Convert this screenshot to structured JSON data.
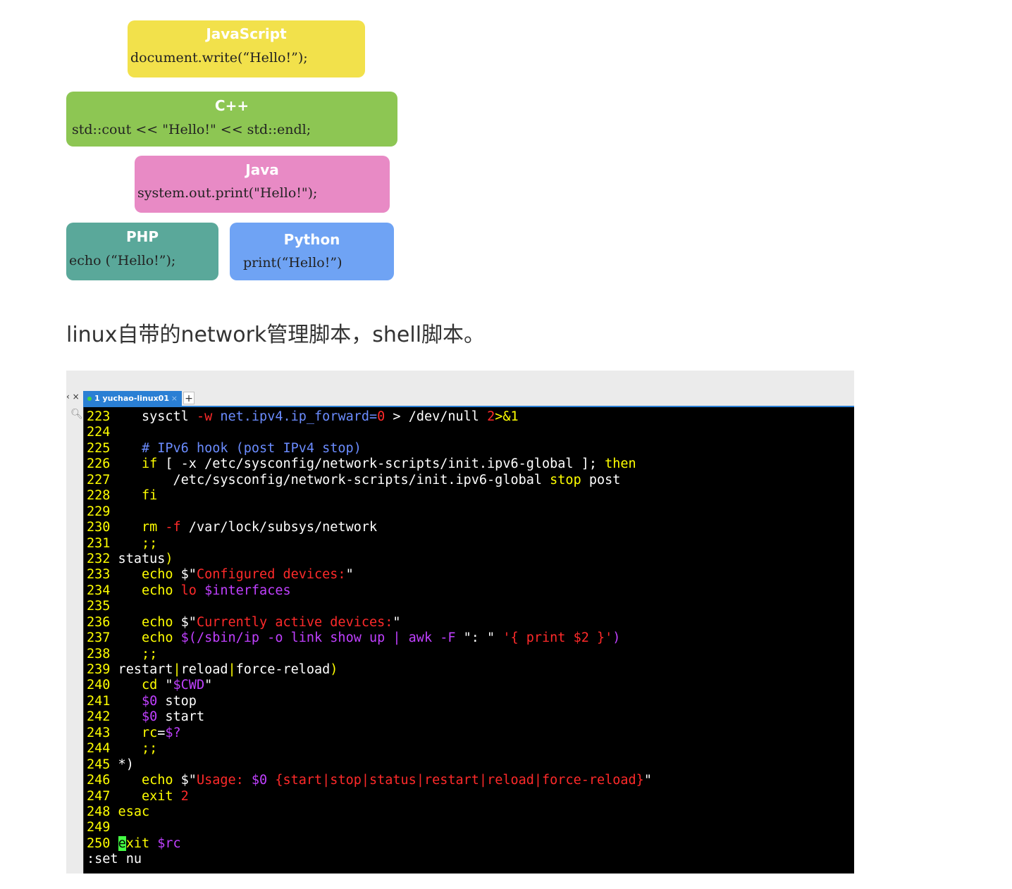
{
  "cards": [
    {
      "title": "JavaScript",
      "code": "document.write(“Hello!”);",
      "color": "#f2e14b"
    },
    {
      "title": "C++",
      "code": "std::cout << \"Hello!\" << std::endl;",
      "color": "#8dc653"
    },
    {
      "title": "Java",
      "code": "system.out.print(\"Hello!\");",
      "color": "#e88ac5"
    },
    {
      "title": "PHP",
      "code": "echo (“Hello!”);",
      "color": "#5aa89a"
    },
    {
      "title": "Python",
      "code": "print(“Hello!”)",
      "color": "#6fa3f4"
    }
  ],
  "caption": "linux自带的network管理脚本，shell脚本。",
  "terminal_tab": {
    "left_ctrl": "‹ ×",
    "label": "1 yuchao-linux01",
    "close": "×",
    "add": "+"
  },
  "terminal": {
    "lines": [
      {
        "n": "223",
        "segs": [
          [
            "pc",
            "    sysctl "
          ],
          [
            "op",
            "-w"
          ],
          [
            "cm",
            " net.ipv4.ip_forward="
          ],
          [
            "op",
            "0"
          ],
          [
            "pc",
            " > /dev/null "
          ],
          [
            "op",
            "2"
          ],
          [
            "kw",
            ">&1"
          ]
        ]
      },
      {
        "n": "224",
        "segs": []
      },
      {
        "n": "225",
        "segs": [
          [
            "cm",
            "    # IPv6 hook (post IPv4 stop)"
          ]
        ]
      },
      {
        "n": "226",
        "segs": [
          [
            "kw",
            "    if"
          ],
          [
            "pc",
            " [ -x /etc/sysconfig/network-scripts/init.ipv6-global ]; "
          ],
          [
            "kw",
            "then"
          ]
        ]
      },
      {
        "n": "227",
        "segs": [
          [
            "pc",
            "        /etc/sysconfig/network-scripts/init.ipv6-global "
          ],
          [
            "kw",
            "stop"
          ],
          [
            "pc",
            " post"
          ]
        ]
      },
      {
        "n": "228",
        "segs": [
          [
            "kw",
            "    fi"
          ]
        ]
      },
      {
        "n": "229",
        "segs": []
      },
      {
        "n": "230",
        "segs": [
          [
            "kw",
            "    rm"
          ],
          [
            "op",
            " -f"
          ],
          [
            "pc",
            " /var/lock/subsys/network"
          ]
        ]
      },
      {
        "n": "231",
        "segs": [
          [
            "kw",
            "    ;;"
          ]
        ]
      },
      {
        "n": "232",
        "segs": [
          [
            "pc",
            " status"
          ],
          [
            "kw",
            ")"
          ]
        ]
      },
      {
        "n": "233",
        "segs": [
          [
            "kw",
            "    echo"
          ],
          [
            "pc",
            " $\""
          ],
          [
            "str",
            "Configured devices:"
          ],
          [
            "pc",
            "\""
          ]
        ]
      },
      {
        "n": "234",
        "segs": [
          [
            "kw",
            "    echo"
          ],
          [
            "op",
            " lo"
          ],
          [
            "vr",
            " $interfaces"
          ]
        ]
      },
      {
        "n": "235",
        "segs": []
      },
      {
        "n": "236",
        "segs": [
          [
            "kw",
            "    echo"
          ],
          [
            "pc",
            " $\""
          ],
          [
            "str",
            "Currently active devices:"
          ],
          [
            "pc",
            "\""
          ]
        ]
      },
      {
        "n": "237",
        "segs": [
          [
            "kw",
            "    echo"
          ],
          [
            "vr",
            " $(/sbin/ip -o link show up | awk -F "
          ],
          [
            "pc",
            "\": \" "
          ],
          [
            "op",
            "'{ print $2 }'"
          ],
          [
            "vr",
            ")"
          ]
        ]
      },
      {
        "n": "238",
        "segs": [
          [
            "kw",
            "    ;;"
          ]
        ]
      },
      {
        "n": "239",
        "segs": [
          [
            "pc",
            " restart"
          ],
          [
            "kw",
            "|"
          ],
          [
            "pc",
            "reload"
          ],
          [
            "kw",
            "|"
          ],
          [
            "pc",
            "force-reload"
          ],
          [
            "kw",
            ")"
          ]
        ]
      },
      {
        "n": "240",
        "segs": [
          [
            "kw",
            "    cd"
          ],
          [
            "pc",
            " \""
          ],
          [
            "vr",
            "$CWD"
          ],
          [
            "pc",
            "\""
          ]
        ]
      },
      {
        "n": "241",
        "segs": [
          [
            "vr",
            "    $0"
          ],
          [
            "pc",
            " stop"
          ]
        ]
      },
      {
        "n": "242",
        "segs": [
          [
            "vr",
            "    $0"
          ],
          [
            "pc",
            " start"
          ]
        ]
      },
      {
        "n": "243",
        "segs": [
          [
            "kw",
            "    rc"
          ],
          [
            "pc",
            "="
          ],
          [
            "vr",
            "$?"
          ]
        ]
      },
      {
        "n": "244",
        "segs": [
          [
            "kw",
            "    ;;"
          ]
        ]
      },
      {
        "n": "245",
        "segs": [
          [
            "pc",
            " *)"
          ]
        ]
      },
      {
        "n": "246",
        "segs": [
          [
            "kw",
            "    echo"
          ],
          [
            "pc",
            " $\""
          ],
          [
            "str",
            "Usage: "
          ],
          [
            "vr",
            "$0"
          ],
          [
            "str",
            " {start|stop|status|restart|reload|force-reload}"
          ],
          [
            "pc",
            "\""
          ]
        ]
      },
      {
        "n": "247",
        "segs": [
          [
            "kw",
            "    exit"
          ],
          [
            "op",
            " 2"
          ]
        ]
      },
      {
        "n": "248",
        "segs": [
          [
            "kw",
            " esac"
          ]
        ]
      },
      {
        "n": "249",
        "segs": []
      },
      {
        "n": "250",
        "segs": [
          [
            "pc",
            " "
          ],
          [
            "cursor",
            "e"
          ],
          [
            "kw",
            "xit"
          ],
          [
            "vr",
            " $rc"
          ]
        ]
      }
    ],
    "command_line": ":set nu"
  }
}
